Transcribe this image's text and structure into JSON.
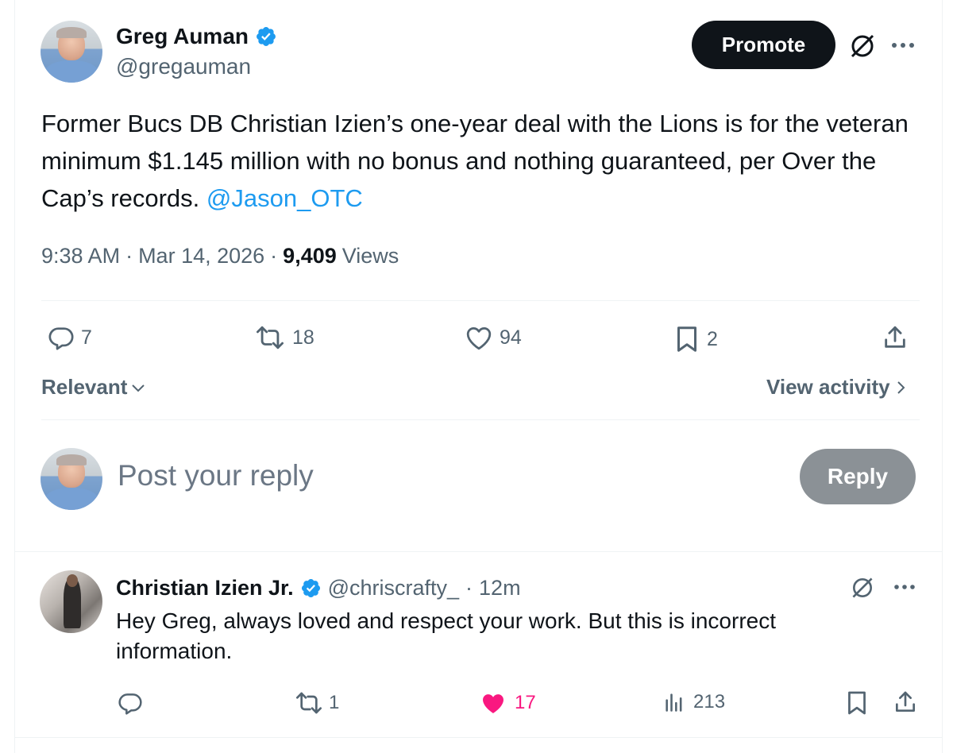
{
  "colors": {
    "text": "#0f1419",
    "muted": "#536471",
    "link": "#1d9bf0",
    "verified": "#1d9bf0",
    "like_active": "#f91880",
    "promote_bg": "#0f1419",
    "reply_btn_bg": "#8b9196"
  },
  "post": {
    "author_name": "Greg Auman",
    "author_handle": "@gregauman",
    "promote_label": "Promote",
    "text_main": "Former Bucs DB Christian Izien’s one-year deal with the Lions is for the veteran minimum $1.145 million with no bonus and nothing guaranteed, per Over the Cap’s records. ",
    "mention": "@Jason_OTC",
    "time": "9:38 AM",
    "date": "Mar 14, 2026",
    "sep": "·",
    "views_count": "9,409",
    "views_label": "Views",
    "stats": {
      "replies": "7",
      "reposts": "18",
      "likes": "94",
      "bookmarks": "2"
    }
  },
  "sort": {
    "label": "Relevant",
    "view_activity": "View activity"
  },
  "composer": {
    "placeholder": "Post your reply",
    "reply_button": "Reply"
  },
  "reply": {
    "author_name": "Christian Izien Jr.",
    "author_handle": "@chriscrafty_",
    "sep": "·",
    "age": "12m",
    "text": "Hey Greg, always loved and respect your work. But this is incorrect information.",
    "stats": {
      "reposts": "1",
      "likes": "17",
      "views": "213"
    }
  },
  "icons": {
    "verified": "verified-badge-icon",
    "grok": "grok-icon",
    "more": "more-icon",
    "reply": "reply-icon",
    "repost": "repost-icon",
    "like": "heart-icon",
    "bookmark": "bookmark-icon",
    "share": "share-icon",
    "views": "analytics-icon",
    "chevron_down": "chevron-down-icon",
    "chevron_right": "chevron-right-icon"
  }
}
